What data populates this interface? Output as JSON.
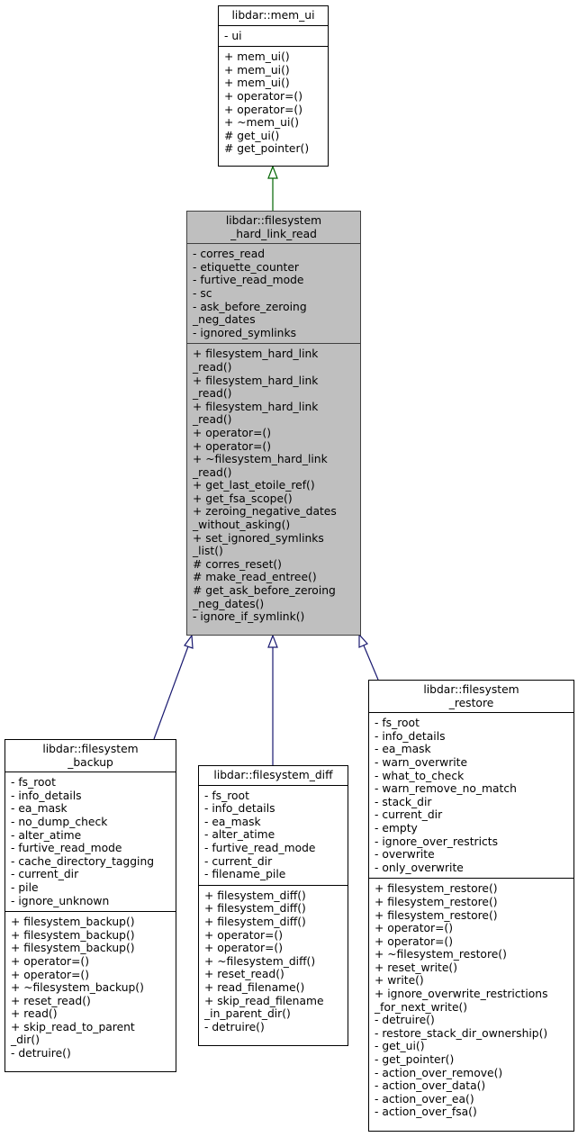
{
  "diagram": {
    "type": "class-inheritance",
    "colors": {
      "base_edge": "#006400",
      "derived_edge": "#191970",
      "focus_fill": "#bfbfbf"
    },
    "classes": {
      "mem_ui": {
        "title": "libdar::mem_ui",
        "attributes": [
          "- ui"
        ],
        "methods": [
          "+ mem_ui()",
          "+ mem_ui()",
          "+ mem_ui()",
          "+ operator=()",
          "+ operator=()",
          "+ ~mem_ui()",
          "# get_ui()",
          "# get_pointer()"
        ]
      },
      "hard_link_read": {
        "title": "libdar::filesystem\n_hard_link_read",
        "attributes": [
          "- corres_read",
          "- etiquette_counter",
          "- furtive_read_mode",
          "- sc",
          "- ask_before_zeroing\n_neg_dates",
          "- ignored_symlinks"
        ],
        "methods": [
          "+ filesystem_hard_link\n_read()",
          "+ filesystem_hard_link\n_read()",
          "+ filesystem_hard_link\n_read()",
          "+ operator=()",
          "+ operator=()",
          "+ ~filesystem_hard_link\n_read()",
          "+ get_last_etoile_ref()",
          "+ get_fsa_scope()",
          "+ zeroing_negative_dates\n_without_asking()",
          "+ set_ignored_symlinks\n_list()",
          "# corres_reset()",
          "# make_read_entree()",
          "# get_ask_before_zeroing\n_neg_dates()",
          "- ignore_if_symlink()"
        ]
      },
      "backup": {
        "title": "libdar::filesystem\n_backup",
        "attributes": [
          "- fs_root",
          "- info_details",
          "- ea_mask",
          "- no_dump_check",
          "- alter_atime",
          "- furtive_read_mode",
          "- cache_directory_tagging",
          "- current_dir",
          "- pile",
          "- ignore_unknown"
        ],
        "methods": [
          "+ filesystem_backup()",
          "+ filesystem_backup()",
          "+ filesystem_backup()",
          "+ operator=()",
          "+ operator=()",
          "+ ~filesystem_backup()",
          "+ reset_read()",
          "+ read()",
          "+ skip_read_to_parent\n_dir()",
          "- detruire()"
        ]
      },
      "diff": {
        "title": "libdar::filesystem_diff",
        "attributes": [
          "- fs_root",
          "- info_details",
          "- ea_mask",
          "- alter_atime",
          "- furtive_read_mode",
          "- current_dir",
          "- filename_pile"
        ],
        "methods": [
          "+ filesystem_diff()",
          "+ filesystem_diff()",
          "+ filesystem_diff()",
          "+ operator=()",
          "+ operator=()",
          "+ ~filesystem_diff()",
          "+ reset_read()",
          "+ read_filename()",
          "+ skip_read_filename\n_in_parent_dir()",
          "- detruire()"
        ]
      },
      "restore": {
        "title": "libdar::filesystem\n_restore",
        "attributes": [
          "- fs_root",
          "- info_details",
          "- ea_mask",
          "- warn_overwrite",
          "- what_to_check",
          "- warn_remove_no_match",
          "- stack_dir",
          "- current_dir",
          "- empty",
          "- ignore_over_restricts",
          "- overwrite",
          "- only_overwrite"
        ],
        "methods": [
          "+ filesystem_restore()",
          "+ filesystem_restore()",
          "+ filesystem_restore()",
          "+ operator=()",
          "+ operator=()",
          "+ ~filesystem_restore()",
          "+ reset_write()",
          "+ write()",
          "+ ignore_overwrite_restrictions\n_for_next_write()",
          "- detruire()",
          "- restore_stack_dir_ownership()",
          "- get_ui()",
          "- get_pointer()",
          "- action_over_remove()",
          "- action_over_data()",
          "- action_over_ea()",
          "- action_over_fsa()"
        ]
      }
    },
    "edges": [
      {
        "from": "hard_link_read",
        "to": "mem_ui",
        "kind": "inherits"
      },
      {
        "from": "backup",
        "to": "hard_link_read",
        "kind": "inherits"
      },
      {
        "from": "diff",
        "to": "hard_link_read",
        "kind": "inherits"
      },
      {
        "from": "restore",
        "to": "hard_link_read",
        "kind": "inherits"
      }
    ]
  }
}
